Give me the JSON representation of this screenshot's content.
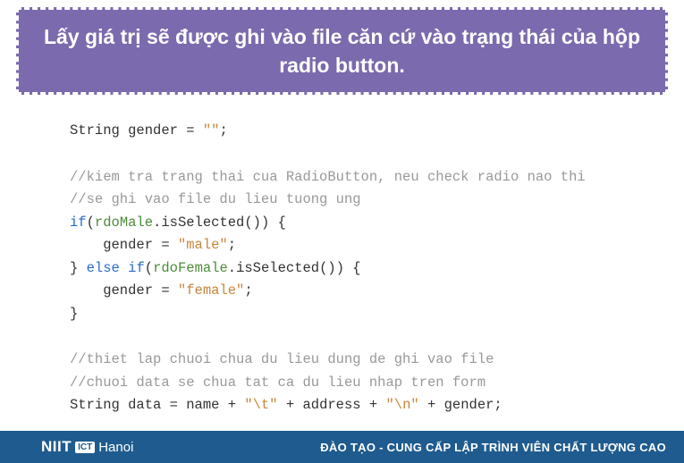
{
  "header": {
    "title": "Lấy giá trị sẽ được ghi vào file căn cứ vào trạng thái của hộp radio button."
  },
  "code": {
    "l1_a": "String gender = ",
    "l1_b": "\"\"",
    "l1_c": ";",
    "c1": "//kiem tra trang thai cua RadioButton, neu check radio nao thi",
    "c2": "//se ghi vao file du lieu tuong ung",
    "l3_kw1": "if",
    "l3_a": "(",
    "l3_id": "rdoMale",
    "l3_b": ".isSelected()) {",
    "l4_a": "    gender = ",
    "l4_b": "\"male\"",
    "l4_c": ";",
    "l5_a": "} ",
    "l5_kw1": "else",
    "l5_b": " ",
    "l5_kw2": "if",
    "l5_c": "(",
    "l5_id": "rdoFemale",
    "l5_d": ".isSelected()) {",
    "l6_a": "    gender = ",
    "l6_b": "\"female\"",
    "l6_c": ";",
    "l7": "}",
    "c3": "//thiet lap chuoi chua du lieu dung de ghi vao file",
    "c4": "//chuoi data se chua tat ca du lieu nhap tren form",
    "l8_a": "String data = name + ",
    "l8_b": "\"\\t\"",
    "l8_c": " + address + ",
    "l8_d": "\"\\n\"",
    "l8_e": " + gender;"
  },
  "footer": {
    "logo_niit": "NIIT",
    "logo_badge": "ICT",
    "logo_hanoi": "Hanoi",
    "tagline": "ĐÀO TẠO - CUNG CẤP LẬP TRÌNH VIÊN CHẤT LƯỢNG CAO"
  }
}
